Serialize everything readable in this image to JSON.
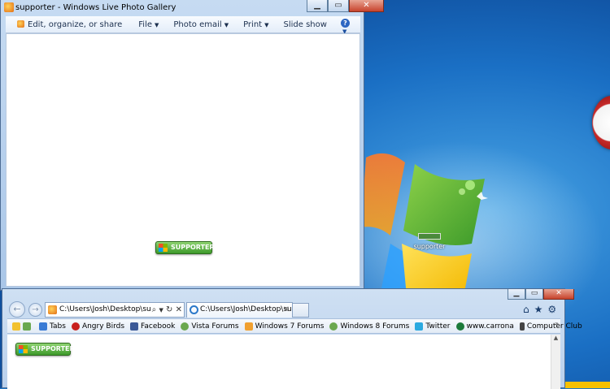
{
  "gallery": {
    "title": "supporter - Windows Live Photo Gallery",
    "toolbar": {
      "edit_label": "Edit, organize, or share",
      "file_label": "File",
      "photo_email_label": "Photo email",
      "print_label": "Print",
      "slideshow_label": "Slide show"
    },
    "badge_label": "SUPPORTER"
  },
  "desktop": {
    "icon_label": "supporter"
  },
  "ie": {
    "address_value": "C:\\Users\\Josh\\Desktop\\suppor",
    "tab_label": "C:\\Users\\Josh\\Desktop\\sup...",
    "favorites": [
      {
        "label": "Tabs",
        "color": "#3a7bd5"
      },
      {
        "label": "Angry Birds",
        "color": "#c8201e"
      },
      {
        "label": "Facebook",
        "color": "#3b5998"
      },
      {
        "label": "Vista Forums",
        "color": "#6aa84f"
      },
      {
        "label": "Windows 7 Forums",
        "color": "#f0a030"
      },
      {
        "label": "Windows 8 Forums",
        "color": "#6aa84f"
      },
      {
        "label": "Twitter",
        "color": "#2aa9e0"
      },
      {
        "label": "www.carrona",
        "color": "#1b7a3a"
      },
      {
        "label": "Computer Club",
        "color": "#444444"
      }
    ],
    "page_badge_label": "SUPPORTER"
  }
}
